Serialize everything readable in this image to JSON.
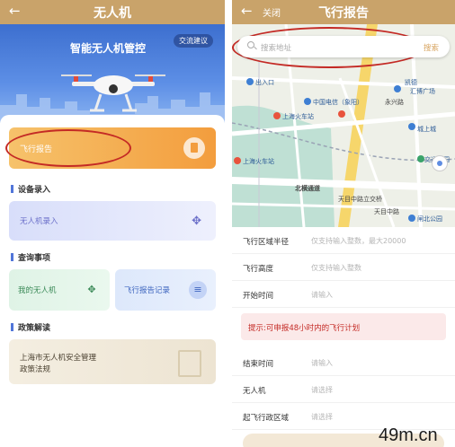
{
  "left": {
    "title": "无人机",
    "back_icon": "←",
    "hero_title": "智能无人机管控",
    "feedback_chip": "交流建议",
    "report_banner": "飞行报告",
    "sections": {
      "device": "设备录入",
      "query": "查询事项",
      "policy": "政策解读"
    },
    "uav_entry": "无人机录入",
    "my_uav": "我的无人机",
    "flight_records": "飞行报告记录",
    "policy_line1": "上海市无人机安全管理",
    "policy_line2": "政策法规"
  },
  "right": {
    "title": "飞行报告",
    "back_icon": "←",
    "close": "关闭",
    "search_placeholder": "搜索地址",
    "search_button": "搜索",
    "map_labels": {
      "chukou": "出入口",
      "xiangyang": "中国电信（象阳）",
      "huochezhan1": "上海火车站",
      "huochezhan2": "上海火车站",
      "yongxing": "永兴路",
      "tianmu": "天目中路立交桥",
      "tianmu2": "天目中路",
      "beiheng": "北横通道",
      "chengshang": "城上城",
      "jiaotong": "交通公园",
      "kailin": "凯德",
      "huibo": "汇博广场",
      "zhabei": "闸北公园"
    },
    "fields": [
      {
        "label": "飞行区域半径",
        "value": "仅支持输入整数，最大20000"
      },
      {
        "label": "飞行高度",
        "value": "仅支持输入整数"
      },
      {
        "label": "开始时间",
        "value": "请输入"
      }
    ],
    "tip": "提示:可申报48小时内的飞行计划",
    "fields2": [
      {
        "label": "结束时间",
        "value": "请输入"
      },
      {
        "label": "无人机",
        "value": "请选择"
      },
      {
        "label": "起飞行政区域",
        "value": "请选择"
      }
    ]
  },
  "watermark": "49m.cn",
  "colors": {
    "header": "#c9a36a",
    "accent_orange": "#f39d3d",
    "annotation_red": "#c42a25",
    "accent_purple": "#6b6fc9"
  }
}
